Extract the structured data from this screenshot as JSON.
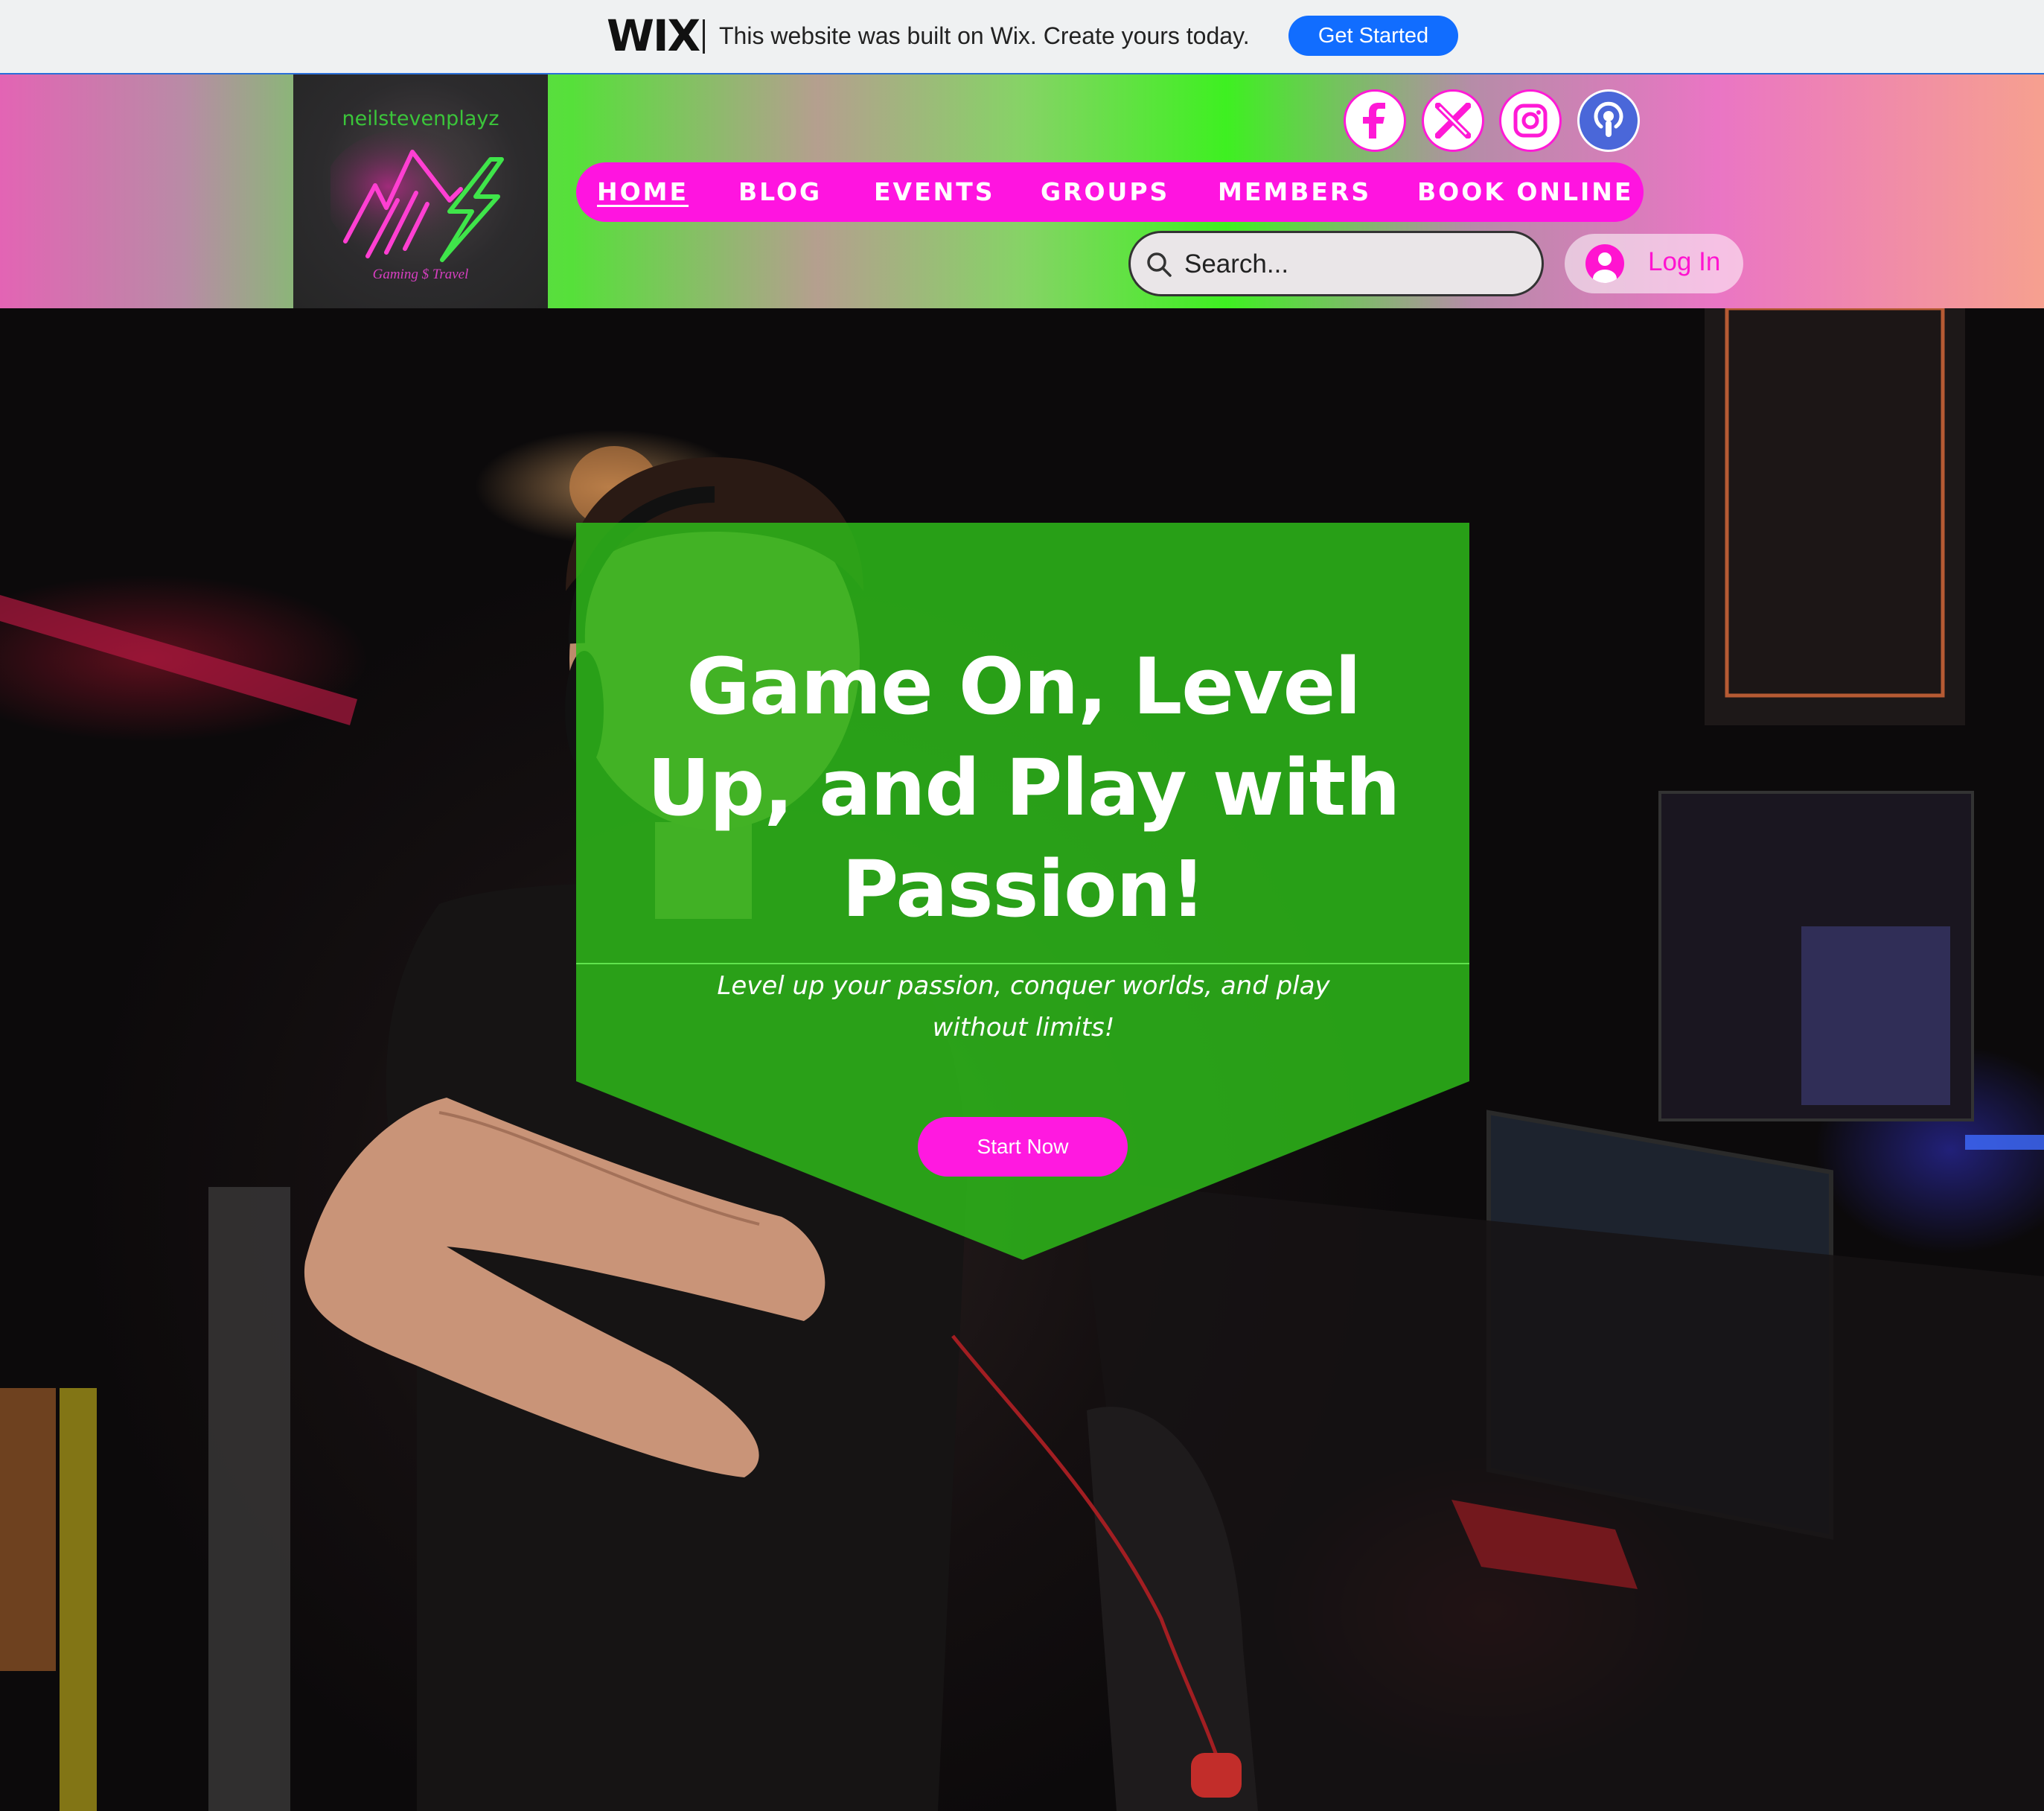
{
  "wix_banner": {
    "logo": "WIX",
    "message": "This website was built on Wix. Create yours today.",
    "cta": "Get Started"
  },
  "site": {
    "logo_name": "neilstevenplayz",
    "logo_tagline": "Gaming $ Travel"
  },
  "social": {
    "icons": [
      "facebook-icon",
      "x-icon",
      "instagram-icon",
      "podcast-icon"
    ]
  },
  "nav": {
    "items": [
      "HOME",
      "BLOG",
      "EVENTS",
      "GROUPS",
      "MEMBERS",
      "BOOK ONLINE"
    ],
    "active": "HOME"
  },
  "search": {
    "placeholder": "Search..."
  },
  "login": {
    "label": "Log In"
  },
  "hero": {
    "title": "Game On, Level Up, and Play with Passion!",
    "subtitle": "Level up your passion, conquer worlds, and play without limits!",
    "cta": "Start Now"
  },
  "colors": {
    "accent_pink": "#ff14e0",
    "accent_green": "#2db81a",
    "wix_blue": "#116dff"
  }
}
